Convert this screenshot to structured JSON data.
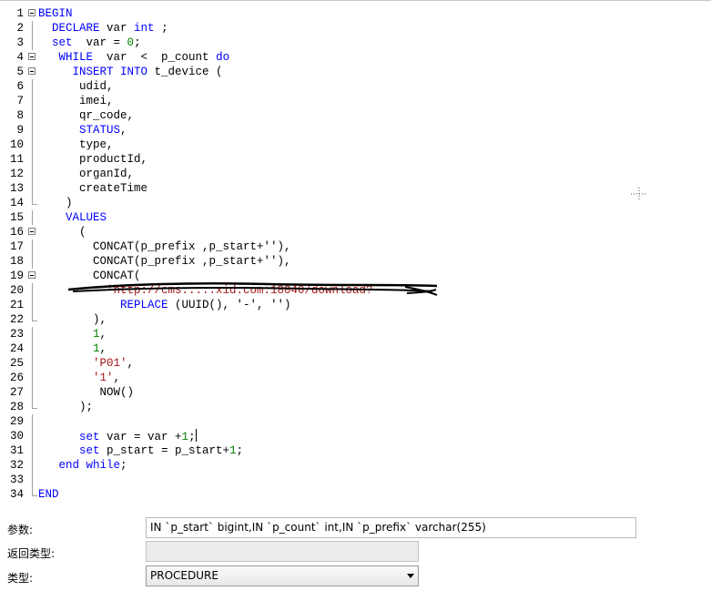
{
  "editor": {
    "lines": [
      {
        "n": "1",
        "indent": "",
        "tokens": [
          [
            "kw",
            "BEGIN"
          ]
        ]
      },
      {
        "n": "2",
        "indent": "  ",
        "tokens": [
          [
            "kw",
            "DECLARE"
          ],
          [
            "txt",
            " var "
          ],
          [
            "kw",
            "int"
          ],
          [
            "txt",
            " ;"
          ]
        ]
      },
      {
        "n": "3",
        "indent": "  ",
        "tokens": [
          [
            "kw",
            "set"
          ],
          [
            "txt",
            "  var = "
          ],
          [
            "num",
            "0"
          ],
          [
            "txt",
            ";"
          ]
        ]
      },
      {
        "n": "4",
        "indent": "   ",
        "tokens": [
          [
            "kw",
            "WHILE"
          ],
          [
            "txt",
            "  var  <  p_count "
          ],
          [
            "kw",
            "do"
          ]
        ]
      },
      {
        "n": "5",
        "indent": "     ",
        "tokens": [
          [
            "kw",
            "INSERT INTO"
          ],
          [
            "txt",
            " t_device ("
          ]
        ]
      },
      {
        "n": "6",
        "indent": "      ",
        "tokens": [
          [
            "txt",
            "udid,"
          ]
        ]
      },
      {
        "n": "7",
        "indent": "      ",
        "tokens": [
          [
            "txt",
            "imei,"
          ]
        ]
      },
      {
        "n": "8",
        "indent": "      ",
        "tokens": [
          [
            "txt",
            "qr_code,"
          ]
        ]
      },
      {
        "n": "9",
        "indent": "      ",
        "tokens": [
          [
            "kw",
            "STATUS"
          ],
          [
            "txt",
            ","
          ]
        ]
      },
      {
        "n": "10",
        "indent": "      ",
        "tokens": [
          [
            "txt",
            "type,"
          ]
        ]
      },
      {
        "n": "11",
        "indent": "      ",
        "tokens": [
          [
            "txt",
            "productId,"
          ]
        ]
      },
      {
        "n": "12",
        "indent": "      ",
        "tokens": [
          [
            "txt",
            "organId,"
          ]
        ]
      },
      {
        "n": "13",
        "indent": "      ",
        "tokens": [
          [
            "txt",
            "createTime"
          ]
        ]
      },
      {
        "n": "14",
        "indent": "    ",
        "tokens": [
          [
            "txt",
            ")"
          ]
        ]
      },
      {
        "n": "15",
        "indent": "    ",
        "tokens": [
          [
            "kw",
            "VALUES"
          ]
        ]
      },
      {
        "n": "16",
        "indent": "      ",
        "tokens": [
          [
            "txt",
            "("
          ]
        ]
      },
      {
        "n": "17",
        "indent": "        ",
        "tokens": [
          [
            "txt",
            "CONCAT(p_prefix ,p_start+''),"
          ]
        ]
      },
      {
        "n": "18",
        "indent": "        ",
        "tokens": [
          [
            "txt",
            "CONCAT(p_prefix ,p_start+''),"
          ]
        ]
      },
      {
        "n": "19",
        "indent": "        ",
        "tokens": [
          [
            "txt",
            "CONCAT("
          ]
        ]
      },
      {
        "n": "20",
        "indent": "          ",
        "tokens": [
          [
            "str",
            "'http://cms.....xid.com:18040/download?"
          ]
        ]
      },
      {
        "n": "21",
        "indent": "            ",
        "tokens": [
          [
            "kw",
            "REPLACE"
          ],
          [
            "txt",
            " (UUID(), '-', '')"
          ]
        ]
      },
      {
        "n": "22",
        "indent": "        ",
        "tokens": [
          [
            "txt",
            "),"
          ]
        ]
      },
      {
        "n": "23",
        "indent": "        ",
        "tokens": [
          [
            "num",
            "1"
          ],
          [
            "txt",
            ","
          ]
        ]
      },
      {
        "n": "24",
        "indent": "        ",
        "tokens": [
          [
            "num",
            "1"
          ],
          [
            "txt",
            ","
          ]
        ]
      },
      {
        "n": "25",
        "indent": "        ",
        "tokens": [
          [
            "str",
            "'P01'"
          ],
          [
            "txt",
            ","
          ]
        ]
      },
      {
        "n": "26",
        "indent": "        ",
        "tokens": [
          [
            "str",
            "'1'"
          ],
          [
            "txt",
            ","
          ]
        ]
      },
      {
        "n": "27",
        "indent": "         ",
        "tokens": [
          [
            "txt",
            "NOW()"
          ]
        ]
      },
      {
        "n": "28",
        "indent": "      ",
        "tokens": [
          [
            "txt",
            ");"
          ]
        ]
      },
      {
        "n": "29",
        "indent": "",
        "tokens": []
      },
      {
        "n": "30",
        "indent": "      ",
        "tokens": [
          [
            "kw",
            "set"
          ],
          [
            "txt",
            " var = var +"
          ],
          [
            "num",
            "1"
          ],
          [
            "txt",
            ";"
          ]
        ],
        "caret": true
      },
      {
        "n": "31",
        "indent": "      ",
        "tokens": [
          [
            "kw",
            "set"
          ],
          [
            "txt",
            " p_start = p_start+"
          ],
          [
            "num",
            "1"
          ],
          [
            "txt",
            ";"
          ]
        ]
      },
      {
        "n": "32",
        "indent": "   ",
        "tokens": [
          [
            "kw",
            "end while"
          ],
          [
            "txt",
            ";"
          ]
        ]
      },
      {
        "n": "33",
        "indent": "",
        "tokens": []
      },
      {
        "n": "34",
        "indent": "",
        "tokens": [
          [
            "kw",
            "END"
          ]
        ]
      }
    ],
    "fold_markers": [
      "1",
      "4",
      "5",
      "16",
      "19"
    ],
    "fold_ends": [
      "14",
      "22",
      "28",
      "34"
    ],
    "colors": {
      "keyword": "#0000ff",
      "number": "#008000",
      "string": "#a31515",
      "text": "#000000"
    }
  },
  "properties": {
    "params_label": "参数:",
    "params_value": "IN `p_start` bigint,IN `p_count` int,IN `p_prefix` varchar(255)",
    "return_label": "返回类型:",
    "return_value": "",
    "type_label": "类型:",
    "type_value": "PROCEDURE"
  }
}
